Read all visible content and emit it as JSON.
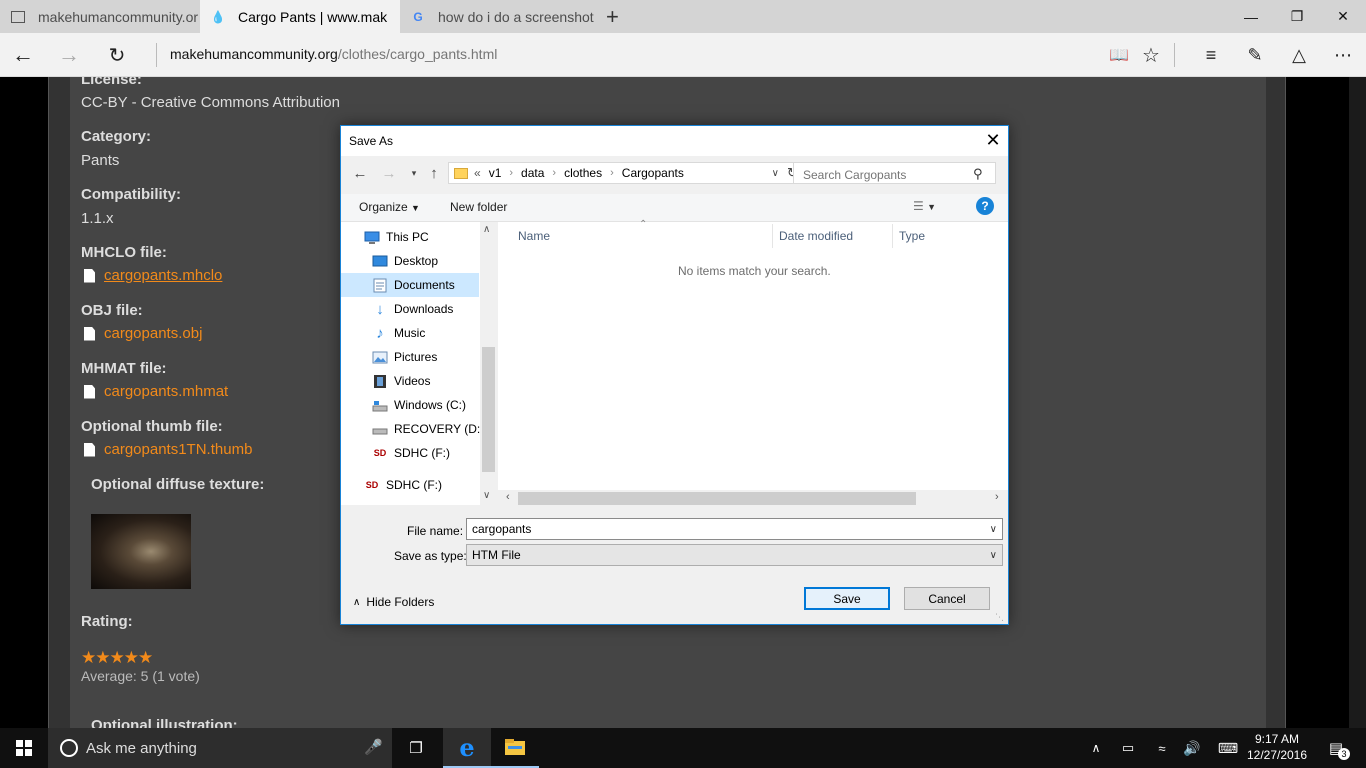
{
  "browser": {
    "tabs": [
      {
        "title": "makehumancommunity.org",
        "icon": "page-icon"
      },
      {
        "title": "Cargo Pants | www.mak",
        "icon": "drupal-icon"
      },
      {
        "title": "how do i do a screenshot or",
        "icon": "google-icon"
      }
    ],
    "address": {
      "host": "makehumancommunity.org",
      "path": "/clothes/cargo_pants.html"
    }
  },
  "page": {
    "license_label": "License:",
    "license_value": "CC-BY - Creative Commons Attribution",
    "category_label": "Category:",
    "category_value": "Pants",
    "compat_label": "Compatibility:",
    "compat_value": "1.1.x",
    "mhclo_label": "MHCLO file:",
    "mhclo_link": "cargopants.mhclo",
    "obj_label": "OBJ file:",
    "obj_link": "cargopants.obj",
    "mhmat_label": "MHMAT file:",
    "mhmat_link": "cargopants.mhmat",
    "thumb_label": "Optional thumb file:",
    "thumb_link": "cargopants1TN.thumb",
    "diffuse_label": "Optional diffuse texture:",
    "rating_label": "Rating:",
    "rating_stars": 5,
    "rating_avg": "Average: 5 (1 vote)",
    "illustration_label": "Optional illustration:"
  },
  "dialog": {
    "title": "Save As",
    "breadcrumb": [
      "«",
      "v1",
      "data",
      "clothes",
      "Cargopants"
    ],
    "search_placeholder": "Search Cargopants",
    "organize": "Organize",
    "new_folder": "New folder",
    "nav_items": [
      {
        "label": "This PC",
        "icon": "computer-icon"
      },
      {
        "label": "Desktop",
        "icon": "desktop-icon"
      },
      {
        "label": "Documents",
        "icon": "documents-icon",
        "selected": true
      },
      {
        "label": "Downloads",
        "icon": "download-icon"
      },
      {
        "label": "Music",
        "icon": "music-icon"
      },
      {
        "label": "Pictures",
        "icon": "pictures-icon"
      },
      {
        "label": "Videos",
        "icon": "videos-icon"
      },
      {
        "label": "Windows (C:)",
        "icon": "drive-icon"
      },
      {
        "label": "RECOVERY (D:)",
        "icon": "drive-icon"
      },
      {
        "label": "SDHC (F:)",
        "icon": "sd-card-icon"
      },
      {
        "label": "SDHC (F:)",
        "icon": "sd-card-icon"
      }
    ],
    "columns": [
      "Name",
      "Date modified",
      "Type"
    ],
    "empty_text": "No items match your search.",
    "filename_label": "File name:",
    "filename_value": "cargopants",
    "savetype_label": "Save as type:",
    "savetype_value": "HTM File",
    "hide_folders": "Hide Folders",
    "save": "Save",
    "cancel": "Cancel"
  },
  "taskbar": {
    "search_placeholder": "Ask me anything",
    "time": "9:17 AM",
    "date": "12/27/2016",
    "notifications": "3"
  },
  "colors": {
    "accent": "#1883d7",
    "link": "#f28a1a",
    "page_bg": "#454545"
  }
}
